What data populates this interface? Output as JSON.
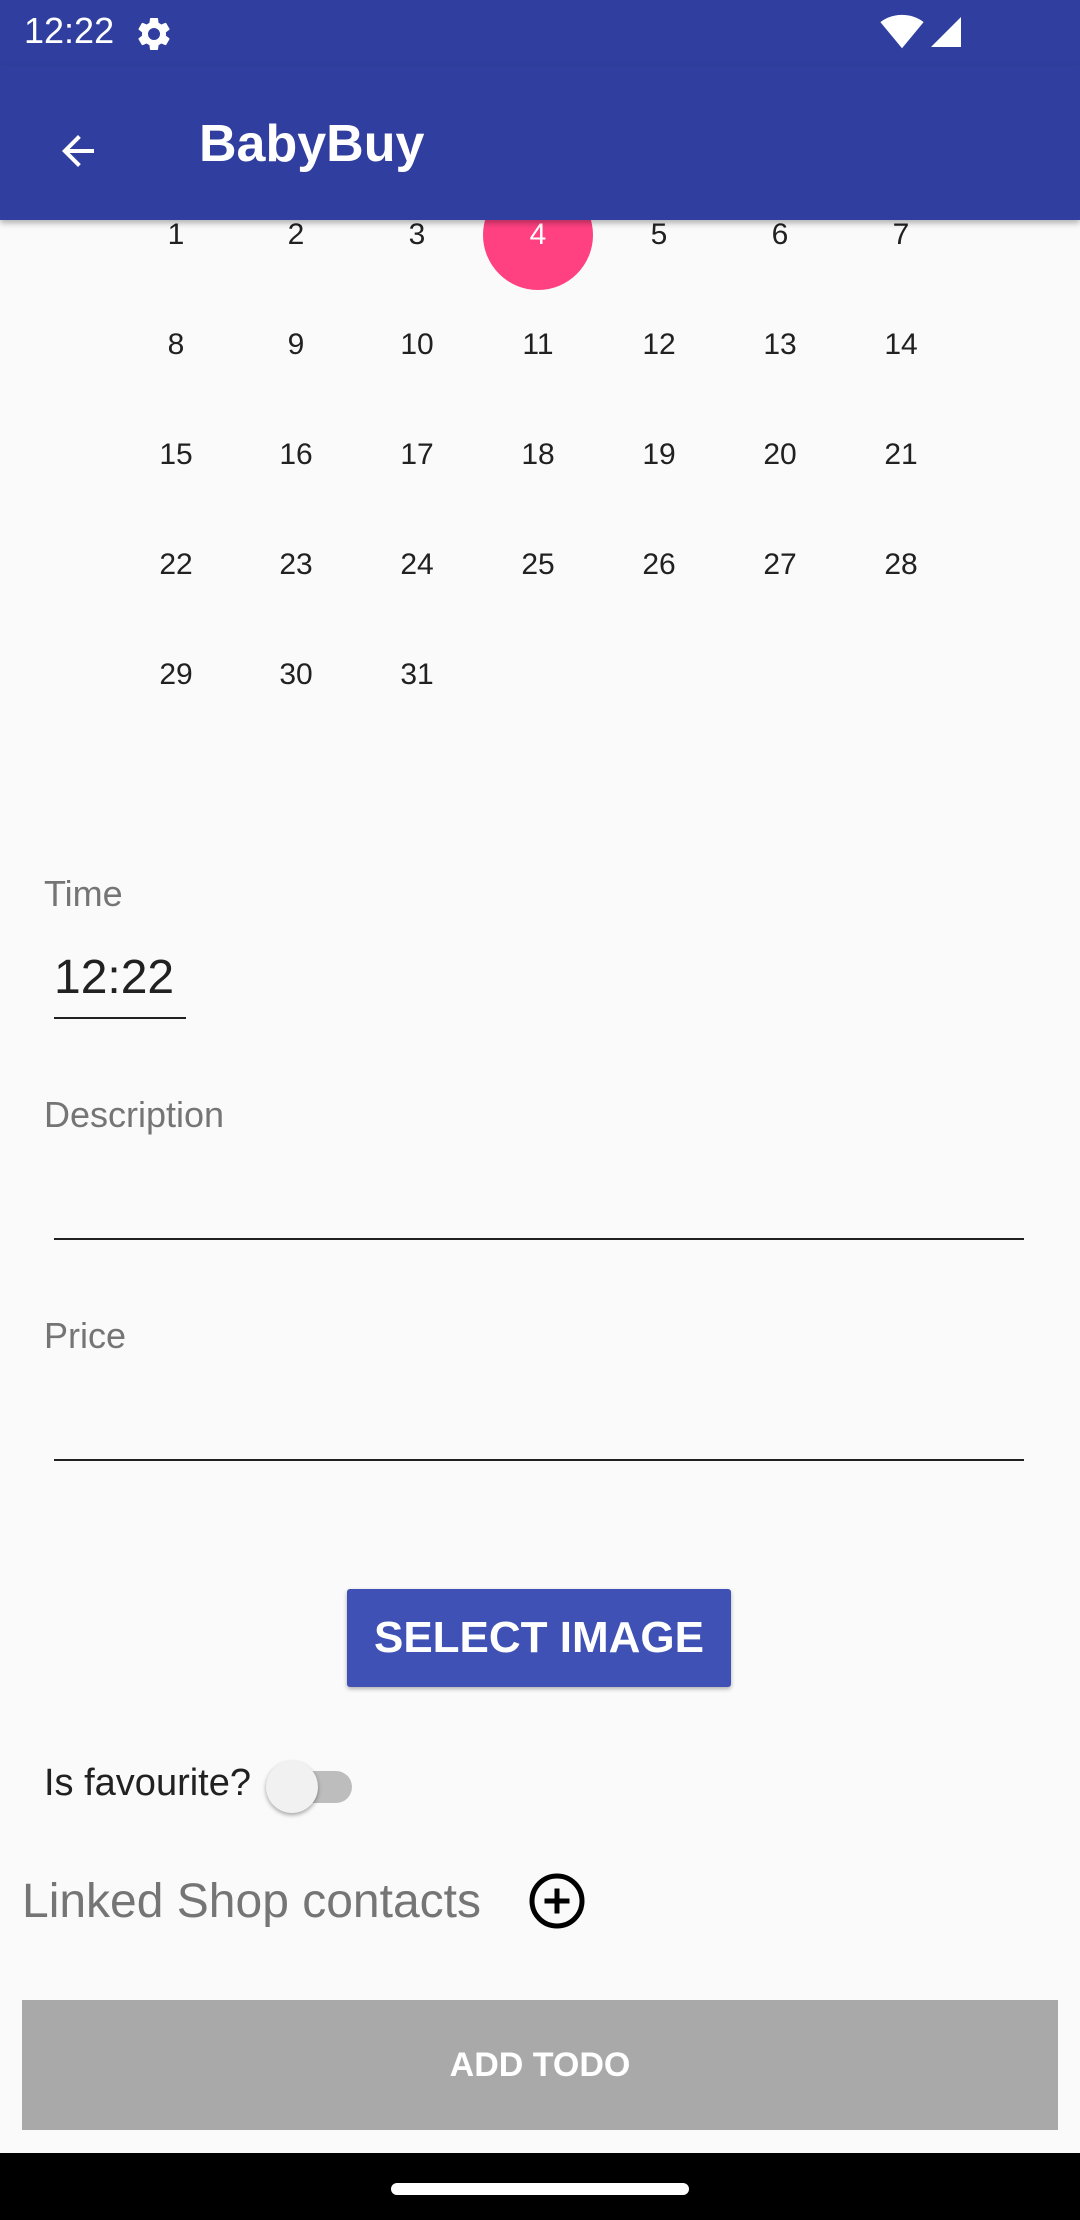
{
  "status_bar": {
    "time": "12:22",
    "icons": [
      "gear-icon",
      "wifi-icon",
      "signal-icon"
    ]
  },
  "app_bar": {
    "title": "BabyBuy",
    "back_icon": "arrow-back-icon"
  },
  "calendar": {
    "selected_day": "4",
    "selected_color": "#ff4081",
    "weeks": [
      [
        "1",
        "2",
        "3",
        "4",
        "5",
        "6",
        "7"
      ],
      [
        "8",
        "9",
        "10",
        "11",
        "12",
        "13",
        "14"
      ],
      [
        "15",
        "16",
        "17",
        "18",
        "19",
        "20",
        "21"
      ],
      [
        "22",
        "23",
        "24",
        "25",
        "26",
        "27",
        "28"
      ],
      [
        "29",
        "30",
        "31"
      ]
    ]
  },
  "form": {
    "time_label": "Time",
    "time_value": "12:22",
    "description_label": "Description",
    "description_value": "",
    "price_label": "Price",
    "price_value": "",
    "select_image_label": "SELECT IMAGE",
    "favourite_label": "Is favourite?",
    "favourite_on": false,
    "linked_contacts_label": "Linked Shop contacts",
    "add_todo_label": "ADD TODO"
  },
  "colors": {
    "primary": "#3f51b5",
    "primary_dark": "#303f9f",
    "accent": "#ff4081",
    "disabled_button": "#a9a9a9"
  }
}
